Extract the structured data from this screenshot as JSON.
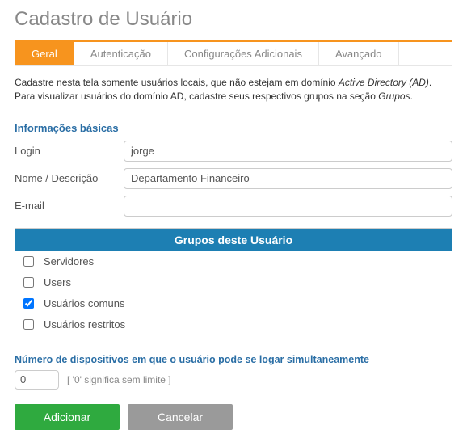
{
  "title": "Cadastro de Usuário",
  "tabs": [
    {
      "label": "Geral",
      "active": true
    },
    {
      "label": "Autenticação",
      "active": false
    },
    {
      "label": "Configurações Adicionais",
      "active": false
    },
    {
      "label": "Avançado",
      "active": false
    }
  ],
  "instructions": {
    "line1_a": "Cadastre nesta tela somente usuários locais, que não estejam em domínio ",
    "line1_b": "Active Directory (AD)",
    "line1_c": ".",
    "line2_a": "Para visualizar usuários do domínio AD, cadastre seus respectivos grupos na seção ",
    "line2_b": "Grupos",
    "line2_c": "."
  },
  "basic_info": {
    "heading": "Informações básicas",
    "login_label": "Login",
    "login_value": "jorge",
    "name_label": "Nome / Descrição",
    "name_value": "Departamento Financeiro",
    "email_label": "E-mail",
    "email_value": ""
  },
  "groups": {
    "heading": "Grupos deste Usuário",
    "items": [
      {
        "label": "Servidores",
        "checked": false
      },
      {
        "label": "Users",
        "checked": false
      },
      {
        "label": "Usuários comuns",
        "checked": true
      },
      {
        "label": "Usuários restritos",
        "checked": false
      }
    ]
  },
  "devices": {
    "label": "Número de dispositivos em que o usuário pode se logar simultaneamente",
    "value": "0",
    "hint": "[ '0' significa sem limite ]"
  },
  "buttons": {
    "add": "Adicionar",
    "cancel": "Cancelar"
  }
}
